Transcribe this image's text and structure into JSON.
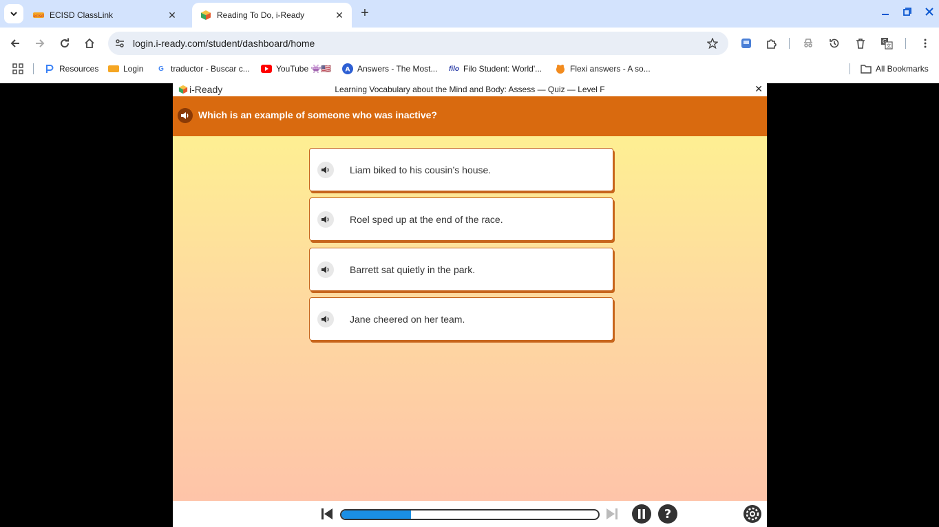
{
  "browser": {
    "tabs": [
      {
        "title": "ECISD ClassLink",
        "active": false
      },
      {
        "title": "Reading To Do, i-Ready",
        "active": true
      }
    ],
    "url": "login.i-ready.com/student/dashboard/home",
    "bookmarks": [
      {
        "label": "Resources",
        "icon": "pages-icon"
      },
      {
        "label": "Login",
        "icon": "classlink-icon"
      },
      {
        "label": "traductor - Buscar c...",
        "icon": "google-icon"
      },
      {
        "label": "YouTube 👾🇺🇸",
        "icon": "youtube-icon"
      },
      {
        "label": "Answers - The Most...",
        "icon": "answers-icon"
      },
      {
        "label": "Filo Student: World'...",
        "icon": "filo-icon"
      },
      {
        "label": "Flexi answers - A so...",
        "icon": "flexi-icon"
      }
    ],
    "all_bookmarks": "All Bookmarks",
    "filo_logo_text": "filo"
  },
  "app": {
    "logo": "i-Ready",
    "lesson_title": "Learning Vocabulary about the Mind and Body: Assess — Quiz — Level F",
    "close": "✕",
    "question": "Which is an example of someone who was inactive?",
    "choices": [
      "Liam biked to his cousin’s house.",
      "Roel sped up at the end of the race.",
      "Barrett sat quietly in the park.",
      "Jane cheered on her team."
    ],
    "progress_fraction": 0.27,
    "colors": {
      "question_bar": "#d96a0f",
      "choice_border": "#c7651c",
      "progress": "#1a8fe5"
    }
  }
}
